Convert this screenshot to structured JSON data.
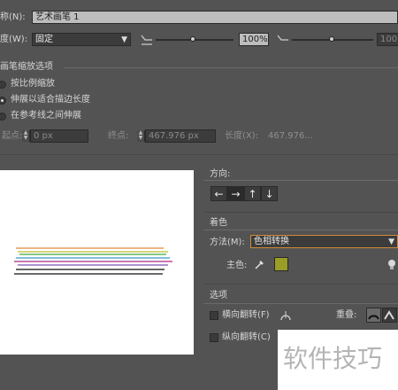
{
  "name_row": {
    "label": "称(N):",
    "value": "艺术画笔 1"
  },
  "width_row": {
    "label": "度(W):",
    "select_value": "固定",
    "percent_value": "100%",
    "percent_value_right": "100"
  },
  "scale_section": {
    "title": "画笔缩放选项",
    "options": [
      "按比例缩放",
      "伸展以适合描边长度",
      "在参考线之间伸展"
    ],
    "selected_index": 1
  },
  "guides_row": {
    "start_label": "起点:",
    "start_value": "0 px",
    "end_label": "终点:",
    "end_value": "467.976 px",
    "length_label": "长度(X):",
    "length_value": "467.976..."
  },
  "direction": {
    "title": "方向:",
    "buttons": [
      "←",
      "→",
      "↑",
      "↓"
    ],
    "selected_index": 1
  },
  "colorization": {
    "title": "着色",
    "method_label": "方法(M):",
    "method_value": "色相转换",
    "key_color_label": "主色:",
    "key_color": "#9a9e26"
  },
  "options": {
    "title": "选项",
    "flip_along_label": "横向翻转(F)",
    "flip_across_label": "纵向翻转(C)",
    "overlap_label": "重叠:"
  },
  "preview": {
    "stroke_colors": [
      "#e29b5c",
      "#c7c955",
      "#5fb55c",
      "#58a7cf",
      "#ba4a96",
      "#8d6fbd",
      "#333333",
      "#3a3a3a"
    ]
  },
  "watermark": "软件技巧"
}
